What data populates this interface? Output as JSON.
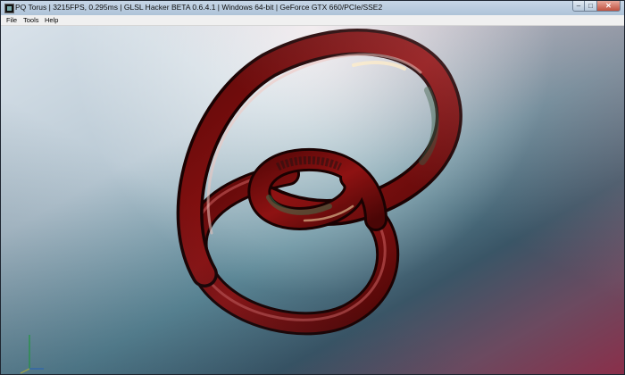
{
  "window": {
    "title": "PQ Torus | 3215FPS, 0.295ms | GLSL Hacker BETA 0.6.4.1 | Windows 64-bit | GeForce GTX 660/PCIe/SSE2",
    "controls": {
      "minimize_icon": "minimize-icon",
      "maximize_icon": "maximize-icon",
      "close_icon": "close-icon"
    }
  },
  "menu": {
    "items": [
      {
        "label": "File"
      },
      {
        "label": "Tools"
      },
      {
        "label": "Help"
      }
    ]
  },
  "scene": {
    "object": "pq-torus-knot",
    "tube_color": "#8a1010",
    "axis_colors": {
      "x": "#3b7bd1",
      "y": "#33b24d",
      "z": "#d1d14a"
    }
  }
}
